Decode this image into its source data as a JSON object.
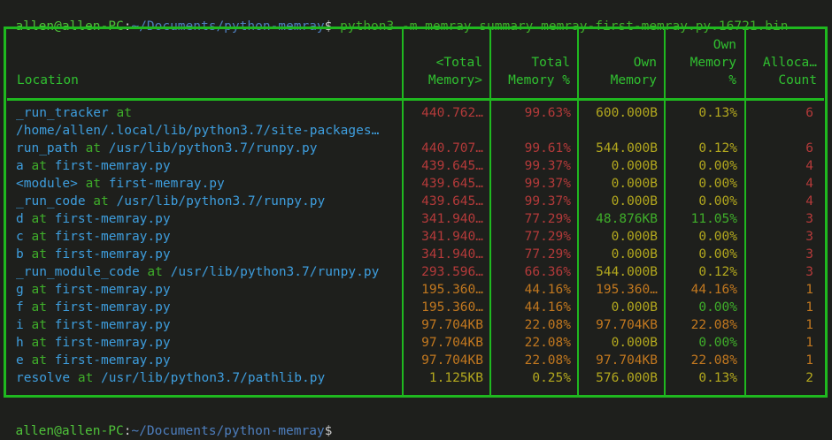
{
  "prompt_top": {
    "user": "allen@allen-PC",
    "sep": ":",
    "path": "~/Documents/python-memray",
    "dollar": "$",
    "command": " python3 -m memray summary memray-first-memray.py.16721.bin"
  },
  "prompt_bottom": {
    "user": "allen@allen-PC",
    "sep": ":",
    "path": "~/Documents/python-memray",
    "dollar": "$"
  },
  "headers": {
    "location": "Location",
    "total_memory": "<Total\nMemory>",
    "total_memory_pct": "Total\nMemory %",
    "own_memory": "Own\nMemory",
    "own_memory_pct": "Own\nMemory\n%",
    "alloc_count": "Alloca…\nCount"
  },
  "colors": {
    "border": "#1fb81f",
    "red": "#b43a3a",
    "orange": "#c2781f",
    "olive": "#b3a81e",
    "green": "#3fae2a",
    "blue": "#3e9ede"
  },
  "rows": [
    {
      "func": "_run_tracker",
      "where": "",
      "wrap": "/home/allen/.local/lib/python3.7/site-packages…",
      "total": "440.762…",
      "total_pct": "99.63%",
      "own": "600.000B",
      "own_pct": "0.13%",
      "count": "6",
      "level": "red",
      "own_level": "olive",
      "ownpct_level": "olive"
    },
    {
      "func": "run_path",
      "where": "/usr/lib/python3.7/runpy.py",
      "total": "440.707…",
      "total_pct": "99.61%",
      "own": "544.000B",
      "own_pct": "0.12%",
      "count": "6",
      "level": "red",
      "own_level": "olive",
      "ownpct_level": "olive"
    },
    {
      "func": "a",
      "where": "first-memray.py",
      "total": "439.645…",
      "total_pct": "99.37%",
      "own": "0.000B",
      "own_pct": "0.00%",
      "count": "4",
      "level": "red",
      "own_level": "olive",
      "ownpct_level": "olive"
    },
    {
      "func": "<module>",
      "where": "first-memray.py",
      "total": "439.645…",
      "total_pct": "99.37%",
      "own": "0.000B",
      "own_pct": "0.00%",
      "count": "4",
      "level": "red",
      "own_level": "olive",
      "ownpct_level": "olive"
    },
    {
      "func": "_run_code",
      "where": "/usr/lib/python3.7/runpy.py",
      "total": "439.645…",
      "total_pct": "99.37%",
      "own": "0.000B",
      "own_pct": "0.00%",
      "count": "4",
      "level": "red",
      "own_level": "olive",
      "ownpct_level": "olive"
    },
    {
      "func": "d",
      "where": "first-memray.py",
      "total": "341.940…",
      "total_pct": "77.29%",
      "own": "48.876KB",
      "own_pct": "11.05%",
      "count": "3",
      "level": "red",
      "own_level": "green",
      "ownpct_level": "green"
    },
    {
      "func": "c",
      "where": "first-memray.py",
      "total": "341.940…",
      "total_pct": "77.29%",
      "own": "0.000B",
      "own_pct": "0.00%",
      "count": "3",
      "level": "red",
      "own_level": "olive",
      "ownpct_level": "olive"
    },
    {
      "func": "b",
      "where": "first-memray.py",
      "total": "341.940…",
      "total_pct": "77.29%",
      "own": "0.000B",
      "own_pct": "0.00%",
      "count": "3",
      "level": "red",
      "own_level": "olive",
      "ownpct_level": "olive"
    },
    {
      "func": "_run_module_code",
      "where": "/usr/lib/python3.7/runpy.py",
      "total": "293.596…",
      "total_pct": "66.36%",
      "own": "544.000B",
      "own_pct": "0.12%",
      "count": "3",
      "level": "red",
      "own_level": "olive",
      "ownpct_level": "olive"
    },
    {
      "func": "g",
      "where": "first-memray.py",
      "total": "195.360…",
      "total_pct": "44.16%",
      "own": "195.360…",
      "own_pct": "44.16%",
      "count": "1",
      "level": "orange",
      "own_level": "orange",
      "ownpct_level": "orange"
    },
    {
      "func": "f",
      "where": "first-memray.py",
      "total": "195.360…",
      "total_pct": "44.16%",
      "own": "0.000B",
      "own_pct": "0.00%",
      "count": "1",
      "level": "orange",
      "own_level": "olive",
      "ownpct_level": "green"
    },
    {
      "func": "i",
      "where": "first-memray.py",
      "total": "97.704KB",
      "total_pct": "22.08%",
      "own": "97.704KB",
      "own_pct": "22.08%",
      "count": "1",
      "level": "orange",
      "own_level": "orange",
      "ownpct_level": "orange"
    },
    {
      "func": "h",
      "where": "first-memray.py",
      "total": "97.704KB",
      "total_pct": "22.08%",
      "own": "0.000B",
      "own_pct": "0.00%",
      "count": "1",
      "level": "orange",
      "own_level": "olive",
      "ownpct_level": "green"
    },
    {
      "func": "e",
      "where": "first-memray.py",
      "total": "97.704KB",
      "total_pct": "22.08%",
      "own": "97.704KB",
      "own_pct": "22.08%",
      "count": "1",
      "level": "orange",
      "own_level": "orange",
      "ownpct_level": "orange"
    },
    {
      "func": "resolve",
      "where": "/usr/lib/python3.7/pathlib.py",
      "total": "1.125KB",
      "total_pct": "0.25%",
      "own": "576.000B",
      "own_pct": "0.13%",
      "count": "2",
      "level": "olive",
      "own_level": "olive",
      "ownpct_level": "olive"
    }
  ],
  "at_word": " at "
}
